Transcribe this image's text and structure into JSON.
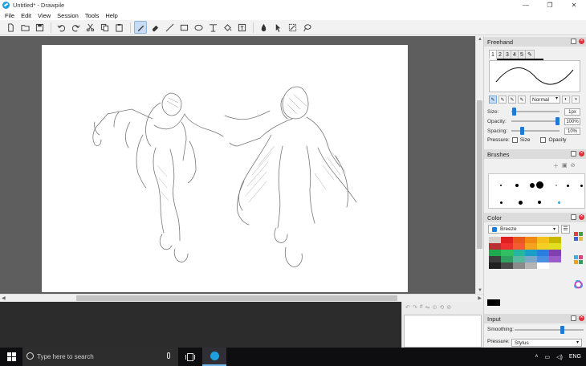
{
  "window": {
    "title": "Untitled* - Drawpile",
    "controls": [
      "—",
      "❐",
      "✕"
    ]
  },
  "menu": [
    "File",
    "Edit",
    "View",
    "Session",
    "Tools",
    "Help"
  ],
  "freehand": {
    "title": "Freehand",
    "tabs": [
      "1",
      "2",
      "3",
      "4",
      "5"
    ],
    "blend_mode": "Normal",
    "size_label": "Size:",
    "size_value": "1px",
    "size_level": 0.02,
    "opacity_label": "Opacity:",
    "opacity_value": "100%",
    "opacity_level": 1.0,
    "spacing_label": "Spacing:",
    "spacing_value": "10%",
    "spacing_level": 0.2,
    "pressure_label": "Pressure:",
    "pressure_size": "Size",
    "pressure_opacity": "Opacity"
  },
  "brushes": {
    "title": "Brushes"
  },
  "color": {
    "title": "Color",
    "palette": "Breeze",
    "swatches": [
      "#d6cfc8",
      "#e02020",
      "#e8581a",
      "#f08a14",
      "#f4c01c",
      "#c8b800",
      "#b83030",
      "#f03030",
      "#f25c30",
      "#f6a21e",
      "#f4d024",
      "#e0e020",
      "#1ea850",
      "#30c060",
      "#26b5a0",
      "#1aa0c8",
      "#2a7ee0",
      "#8040b0",
      "#3c3c3c",
      "#2ea060",
      "#58b89e",
      "#7aa6c8",
      "#4a90e2",
      "#9c5cc8",
      "#202020",
      "#4a4a4a",
      "#8a8a8a",
      "#b4b4b4",
      "#ffffff",
      "#f0f0f0"
    ],
    "current": "#000000"
  },
  "input": {
    "title": "Input",
    "smoothing_label": "Smoothing:",
    "smoothing_level": 0.7,
    "pressure_label": "Pressure:",
    "pressure_value": "Stylus"
  },
  "taskbar": {
    "search_placeholder": "Type here to search",
    "lang": "ENG"
  }
}
